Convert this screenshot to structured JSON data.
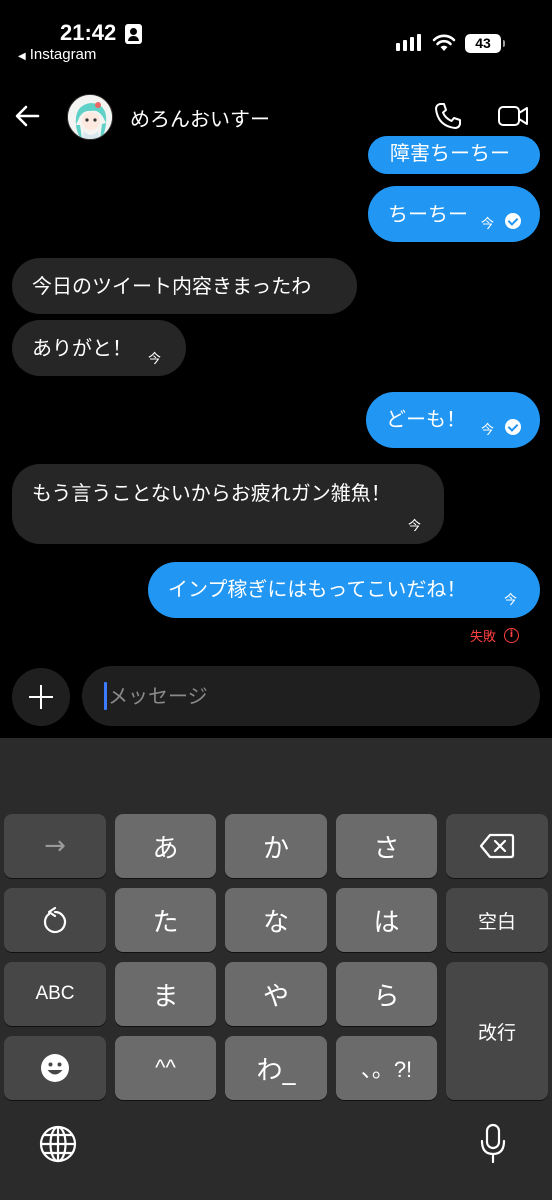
{
  "status_bar": {
    "time": "21:42",
    "back_app": "Instagram",
    "battery": "43"
  },
  "header": {
    "contact_name": "めろんおいすー"
  },
  "messages": [
    {
      "dir": "out",
      "text": "障害ちーちー",
      "receipt": ""
    },
    {
      "dir": "out",
      "text": "ちーちー",
      "receipt": "今",
      "seen": true
    },
    {
      "dir": "in",
      "text": "今日のツイート内容きまったわ",
      "receipt": ""
    },
    {
      "dir": "in",
      "text": "ありがと！",
      "receipt": "今"
    },
    {
      "dir": "out",
      "text": "どーも！",
      "receipt": "今",
      "seen": true
    },
    {
      "dir": "in",
      "text": "もう言うことないからお疲れガン雑魚！",
      "receipt": "今"
    },
    {
      "dir": "out",
      "text": "インプ稼ぎにはもってこいだね！",
      "receipt": "今"
    }
  ],
  "failed_status": "失敗",
  "composer": {
    "placeholder": "メッセージ"
  },
  "keyboard": {
    "row1": [
      "→",
      "あ",
      "か",
      "さ"
    ],
    "row2": [
      "た",
      "な",
      "は",
      "空白"
    ],
    "row3": [
      "ABC",
      "ま",
      "や",
      "ら"
    ],
    "row4": [
      "^^",
      "わ_",
      "、。?!"
    ],
    "return": "改行"
  },
  "colors": {
    "outgoing_bubble": "#2196f3",
    "incoming_bubble": "#262626",
    "error": "#ff4040",
    "caret": "#3a7bff"
  }
}
